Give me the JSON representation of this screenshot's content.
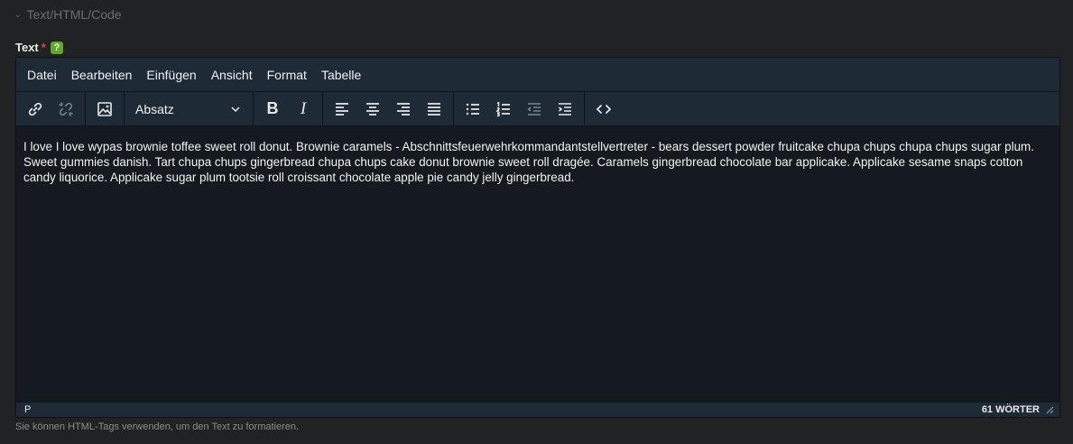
{
  "section": {
    "title": "Text/HTML/Code"
  },
  "field": {
    "label": "Text",
    "required_mark": "*",
    "help_icon": "?"
  },
  "menubar": {
    "items": [
      "Datei",
      "Bearbeiten",
      "Einfügen",
      "Ansicht",
      "Format",
      "Tabelle"
    ]
  },
  "toolbar": {
    "block_format": "Absatz",
    "icons": [
      "link-icon",
      "unlink-icon",
      "image-icon",
      "bold-icon",
      "italic-icon",
      "align-left-icon",
      "align-center-icon",
      "align-right-icon",
      "align-justify-icon",
      "bullet-list-icon",
      "numbered-list-icon",
      "outdent-icon",
      "indent-icon",
      "source-code-icon"
    ],
    "bold_glyph": "B",
    "italic_glyph": "I"
  },
  "content": {
    "text": "I love I love wypas brownie toffee sweet roll donut. Brownie caramels - Abschnittsfeuerwehrkommandantstellvertreter - bears dessert powder fruitcake chupa chups chupa chups sugar plum. Sweet gummies danish. Tart chupa chups gingerbread chupa chups cake donut brownie sweet roll dragée. Caramels gingerbread chocolate bar applicake. Applicake sesame snaps cotton candy liquorice. Applicake sugar plum tootsie roll croissant chocolate apple pie candy jelly gingerbread."
  },
  "statusbar": {
    "path": "P",
    "word_count": "61 WÖRTER"
  },
  "hint": "Sie können HTML-Tags verwenden, um den Text zu formatieren.",
  "colors": {
    "background": "#212223",
    "editor_chrome": "#1e2a36",
    "editor_body": "#151a20",
    "required": "#e0473d",
    "help": "#5fa82a"
  }
}
